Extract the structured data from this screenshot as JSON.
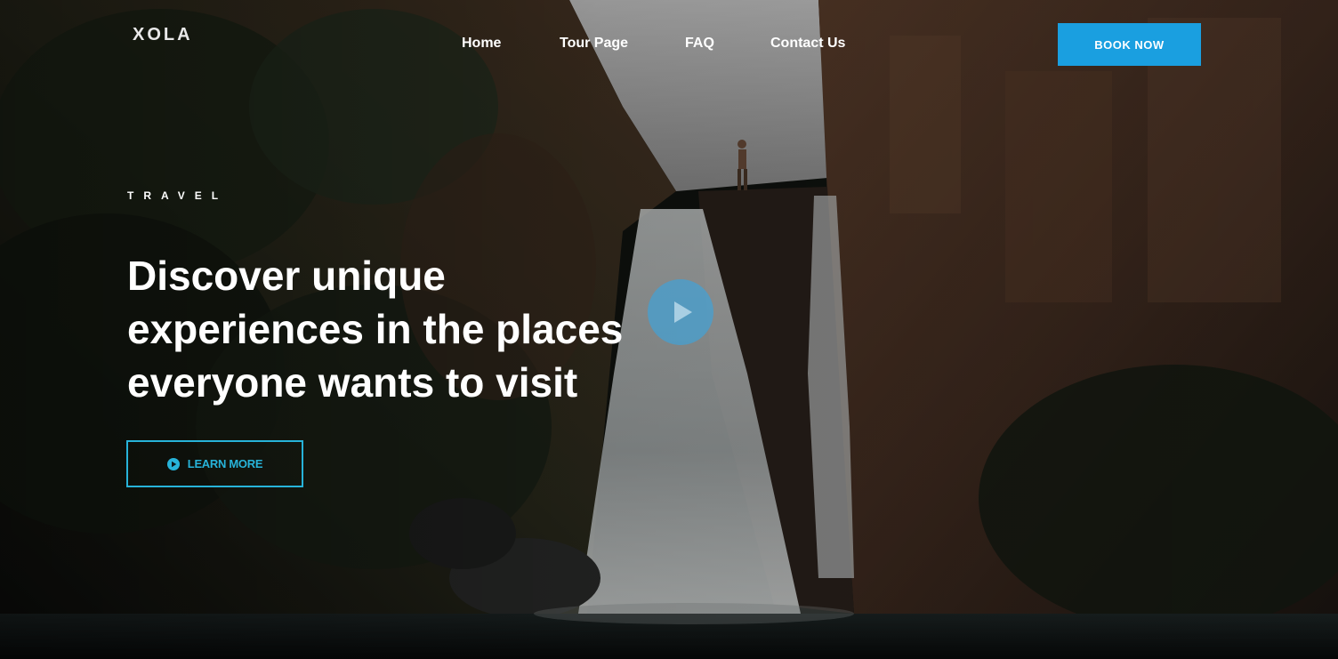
{
  "brand": {
    "logo": "XOLA"
  },
  "nav": {
    "items": [
      "Home",
      "Tour Page",
      "FAQ",
      "Contact Us"
    ],
    "cta_label": "BOOK NOW"
  },
  "hero": {
    "eyebrow": "TRAVEL",
    "headline": "Discover unique experiences in the places everyone wants to visit",
    "learn_more_label": "LEARN MORE",
    "background": "waterfall-canyon-photo"
  },
  "colors": {
    "accent": "#1a9fe0",
    "outline_accent": "#27b3d9",
    "play_button": "#46a0d2"
  },
  "icons": {
    "play": "play-icon",
    "learn_more": "play-circle-icon"
  }
}
